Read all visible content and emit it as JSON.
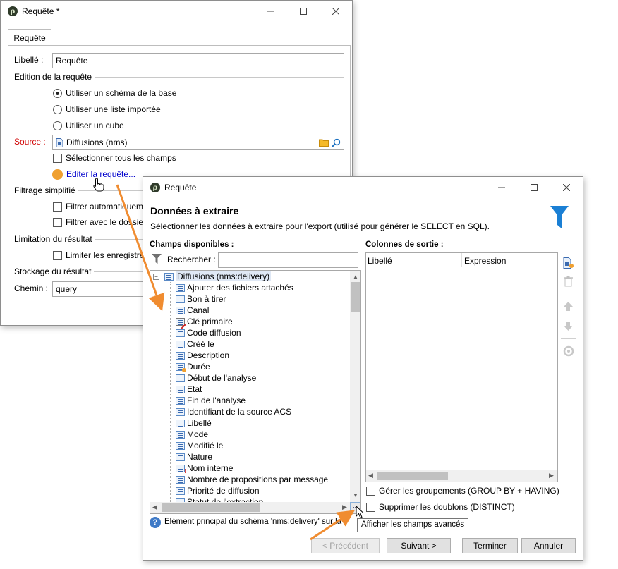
{
  "back_window": {
    "title": "Requête *",
    "tab": "Requête",
    "libelle_label": "Libellé :",
    "libelle_value": "Requête",
    "edition_section": "Edition de la requête",
    "radio_options": [
      "Utiliser un schéma de la base",
      "Utiliser une liste importée",
      "Utiliser un cube"
    ],
    "source_label": "Source :",
    "source_value": "Diffusions (nms)",
    "select_all_fields": "Sélectionner tous les champs",
    "edit_link": "Editer la requête...",
    "filtering_section": "Filtrage simplifié",
    "filter_auto": "Filtrer automatiquem",
    "filter_with": "Filtrer avec le dossier",
    "limit_section": "Limitation du résultat",
    "limit_records": "Limiter les enregistre",
    "storage_section": "Stockage du résultat",
    "path_label": "Chemin :",
    "path_value": "query"
  },
  "front_window": {
    "title": "Requête",
    "heading": "Données à extraire",
    "subheading": "Sélectionner les données à extraire pour l'export (utilisé pour générer le SELECT en SQL).",
    "available_fields_label": "Champs disponibles :",
    "search_label": "Rechercher :",
    "search_value": "",
    "output_columns_label": "Colonnes de sortie :",
    "columns": [
      "Libellé",
      "Expression"
    ],
    "tree_root": "Diffusions (nms:delivery)",
    "tree_items": [
      {
        "label": "Ajouter des fichiers attachés",
        "icon": "field-icon"
      },
      {
        "label": "Bon à tirer",
        "icon": "field-icon"
      },
      {
        "label": "Canal",
        "icon": "field-icon"
      },
      {
        "label": "Clé primaire",
        "icon": "primary-key-icon"
      },
      {
        "label": "Code diffusion",
        "icon": "field-icon"
      },
      {
        "label": "Créé le",
        "icon": "field-icon"
      },
      {
        "label": "Description",
        "icon": "field-icon"
      },
      {
        "label": "Durée",
        "icon": "duration-icon"
      },
      {
        "label": "Début de l'analyse",
        "icon": "field-icon"
      },
      {
        "label": "Etat",
        "icon": "field-icon"
      },
      {
        "label": "Fin de l'analyse",
        "icon": "field-icon"
      },
      {
        "label": "Identifiant de la source ACS",
        "icon": "field-icon"
      },
      {
        "label": "Libellé",
        "icon": "field-icon"
      },
      {
        "label": "Mode",
        "icon": "field-icon"
      },
      {
        "label": "Modifié le",
        "icon": "field-icon"
      },
      {
        "label": "Nature",
        "icon": "field-icon"
      },
      {
        "label": "Nom interne",
        "icon": "required-field-icon"
      },
      {
        "label": "Nombre de propositions par message",
        "icon": "field-icon"
      },
      {
        "label": "Priorité de diffusion",
        "icon": "field-icon"
      },
      {
        "label": "Statut de l'extraction",
        "icon": "field-icon"
      }
    ],
    "group_by_label": "Gérer les groupements (GROUP BY + HAVING)",
    "distinct_label": "Supprimer les doublons (DISTINCT)",
    "info_text": "Elément principal du schéma 'nms:delivery' sur la t",
    "tooltip": "Afficher les champs avancés",
    "buttons": {
      "previous": "< Précédent",
      "next": "Suivant >",
      "finish": "Terminer",
      "cancel": "Annuler"
    }
  },
  "colors": {
    "source_label": "#d00000",
    "link": "#0000cc",
    "accent_orange": "#f0a030",
    "funnel_blue": "#1a7fd4",
    "arrow_orange": "#f08c30"
  }
}
